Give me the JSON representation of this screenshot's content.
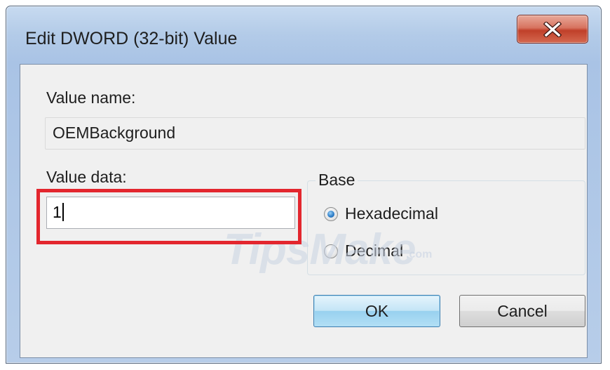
{
  "window": {
    "title": "Edit DWORD (32-bit) Value",
    "close_icon": "close-icon"
  },
  "value_name": {
    "label": "Value name:",
    "value": "OEMBackground"
  },
  "value_data": {
    "label": "Value data:",
    "value": "1"
  },
  "base": {
    "label": "Base",
    "options": [
      {
        "label": "Hexadecimal",
        "selected": true
      },
      {
        "label": "Decimal",
        "selected": false
      }
    ]
  },
  "buttons": {
    "ok": "OK",
    "cancel": "Cancel"
  },
  "watermark": {
    "text": "TipsMake",
    "suffix": ".com"
  },
  "colors": {
    "highlight": "#e3262e",
    "close_button": "#c7432c",
    "radio_selected": "#2f7fc9"
  }
}
